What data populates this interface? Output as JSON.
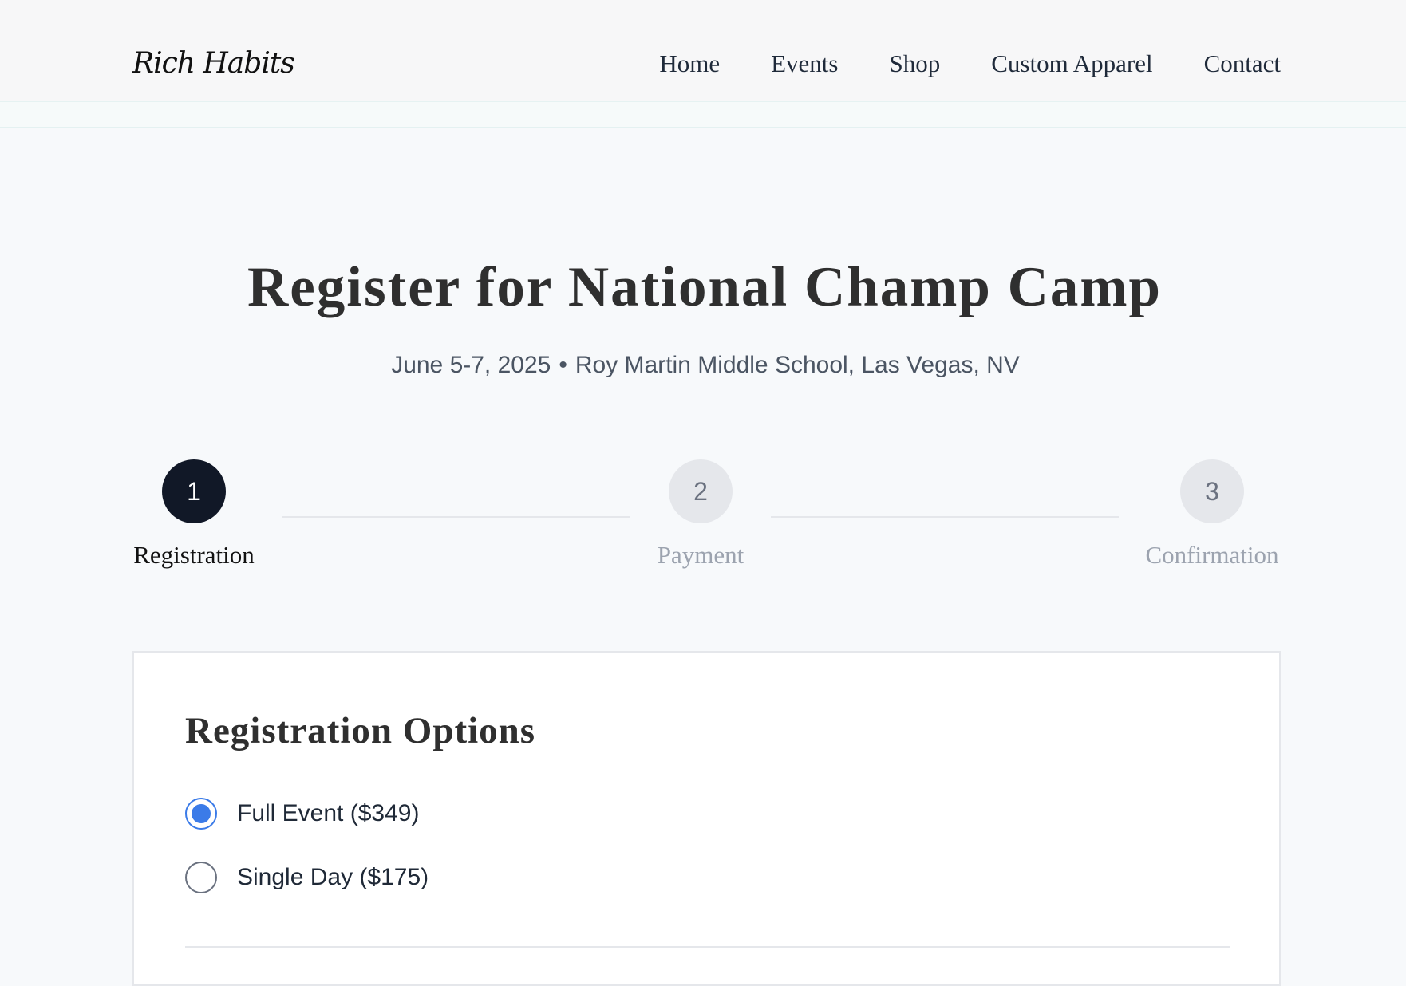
{
  "header": {
    "logo": "Rich Habits",
    "nav": [
      "Home",
      "Events",
      "Shop",
      "Custom Apparel",
      "Contact"
    ]
  },
  "page": {
    "title": "Register for National Champ Camp",
    "date": "June 5-7, 2025",
    "separator": "•",
    "location": "Roy Martin Middle School, Las Vegas, NV"
  },
  "steps": [
    {
      "number": "1",
      "label": "Registration",
      "state": "active"
    },
    {
      "number": "2",
      "label": "Payment",
      "state": "inactive"
    },
    {
      "number": "3",
      "label": "Confirmation",
      "state": "inactive"
    }
  ],
  "card": {
    "title": "Registration Options",
    "options": [
      {
        "label": "Full Event ($349)",
        "selected": true
      },
      {
        "label": "Single Day ($175)",
        "selected": false
      }
    ]
  },
  "colors": {
    "accent": "#3b7be8",
    "active_step": "#111827",
    "inactive_step": "#e5e7eb"
  }
}
